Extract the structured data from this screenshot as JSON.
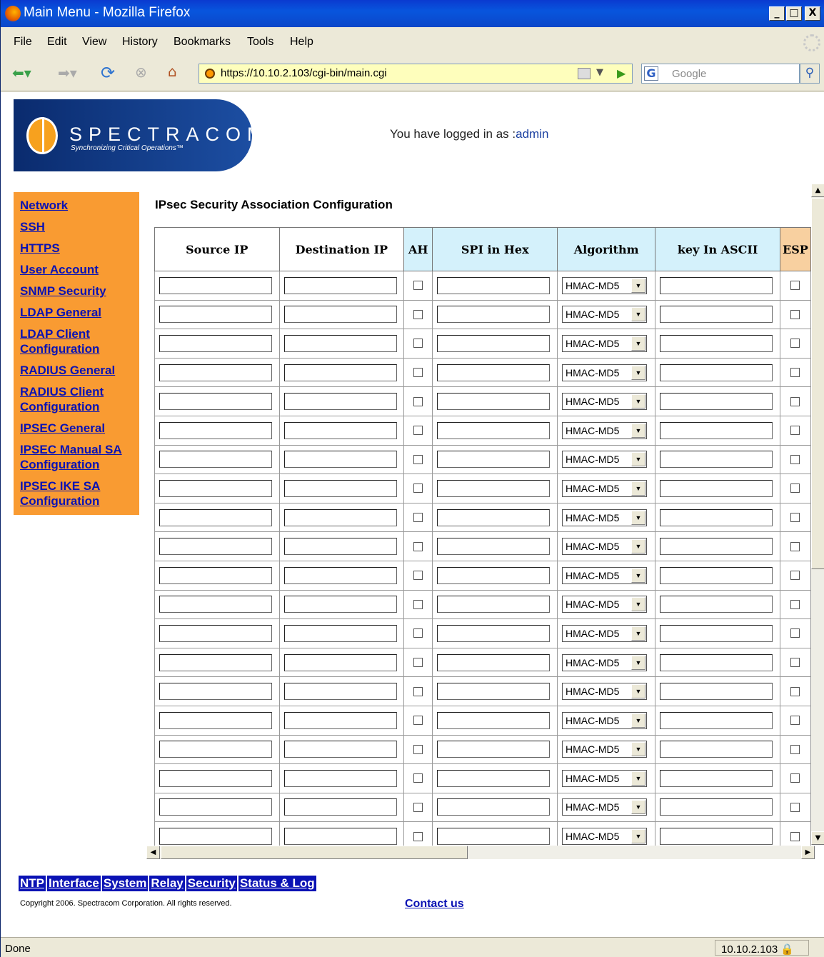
{
  "window": {
    "title": "Main Menu - Mozilla Firefox",
    "min": "_",
    "max": "□",
    "close": "X"
  },
  "menu": [
    "File",
    "Edit",
    "View",
    "History",
    "Bookmarks",
    "Tools",
    "Help"
  ],
  "address": {
    "url": "https://10.10.2.103/cgi-bin/main.cgi"
  },
  "search": {
    "placeholder": "Google"
  },
  "brand": {
    "name": "SPECTRACOM",
    "tagline": "Synchronizing Critical Operations™"
  },
  "login": {
    "prefix": "You have logged in as :",
    "user": "admin"
  },
  "sidebar": [
    "Network",
    "SSH",
    "HTTPS",
    "User Account",
    "SNMP Security",
    "LDAP General",
    "LDAP Client Configuration",
    "RADIUS General",
    "RADIUS Client Configuration",
    "IPSEC General",
    "IPSEC Manual SA Configuration",
    "IPSEC IKE SA Configuration"
  ],
  "page_title": "IPsec Security Association Configuration",
  "table": {
    "headers": [
      "Source IP",
      "Destination IP",
      "AH",
      "SPI in Hex",
      "Algorithm",
      "key In ASCII",
      "ESP"
    ],
    "row_count": 20,
    "algorithm_value": "HMAC-MD5"
  },
  "bottom_nav": [
    "NTP",
    "Interface",
    "System",
    "Relay",
    "Security",
    "Status & Log"
  ],
  "copyright": "Copyright 2006. Spectracom Corporation. All rights reserved.",
  "contact": "Contact us",
  "status": {
    "left": "Done",
    "host": "10.10.2.103"
  },
  "colors": {
    "sidebar_bg": "#f99b32",
    "link": "#0a12b4",
    "ah_header": "#d4f1fb",
    "esp_header": "#f8d0a0"
  }
}
